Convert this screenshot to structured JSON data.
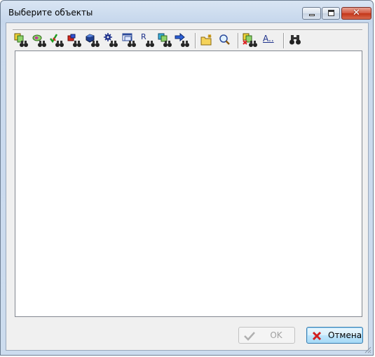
{
  "window": {
    "title": "Выберите объекты"
  },
  "toolbar": {
    "buttons": [
      {
        "icon": "find-objects-icon"
      },
      {
        "icon": "find-links-icon"
      },
      {
        "icon": "find-checked-icon"
      },
      {
        "icon": "find-elements-icon"
      },
      {
        "icon": "find-blocks-icon"
      },
      {
        "icon": "find-settings-icon"
      },
      {
        "icon": "find-windows-icon"
      },
      {
        "icon": "find-references-icon"
      },
      {
        "icon": "find-copies-icon"
      },
      {
        "icon": "find-go-to-icon"
      },
      {
        "icon": "new-folder-icon"
      },
      {
        "icon": "search-icon"
      },
      {
        "icon": "find-delete-icon"
      },
      {
        "icon": "font-text-icon",
        "text": "A.."
      },
      {
        "icon": "binoculars-icon"
      }
    ],
    "references_letter": "R"
  },
  "dialog": {
    "ok_label": "OK",
    "cancel_label": "Отмена"
  },
  "colors": {
    "accent": "#3c7fb1",
    "close_red": "#c33518"
  }
}
